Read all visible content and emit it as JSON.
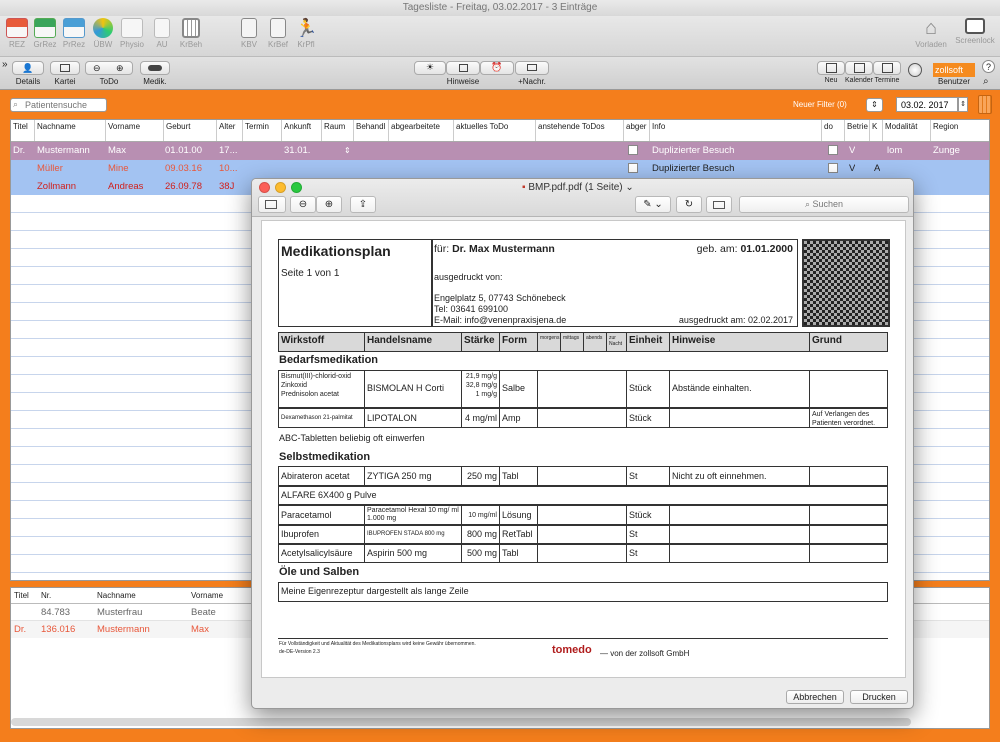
{
  "window": {
    "title": "Tagesliste - Freitag, 03.02.2017 - 3 Einträge"
  },
  "toolbar": {
    "items": [
      {
        "label": "REZ"
      },
      {
        "label": "GrRez"
      },
      {
        "label": "PrRez"
      },
      {
        "label": "ÜBW"
      },
      {
        "label": "Physio"
      },
      {
        "label": "AU"
      },
      {
        "label": "KrBeh"
      },
      {
        "label": "KBV"
      },
      {
        "label": "KrBef"
      },
      {
        "label": "KrPfl"
      }
    ],
    "vorladen": "Vorladen",
    "screenlock": "Screenlock"
  },
  "toolbar2": {
    "details": "Details",
    "kartei": "Kartei",
    "todo": "ToDo",
    "medik": "Medik.",
    "hinweise": "Hinweise",
    "nachr": "+Nachr.",
    "neu": "Neu",
    "kalender": "Kalender",
    "termine": "Termine",
    "user_badge": "zollsoft",
    "benutzer": "Benutzer"
  },
  "filterbar": {
    "search_placeholder": "Patientensuche",
    "filter_label": "Neuer Filter (0)",
    "date": "03.02. 2017"
  },
  "list": {
    "headers": [
      "Titel",
      "Nachname",
      "Vorname",
      "Geburt",
      "Alter",
      "Termin",
      "Ankunft",
      "Raum",
      "Behandl",
      "abgearbeitete",
      "aktuelles ToDo",
      "anstehende ToDos",
      "abger",
      "Info",
      "do",
      "Betrie",
      "K",
      "Modalität",
      "Region"
    ],
    "rows": [
      {
        "titel": "Dr.",
        "nachname": "Mustermann",
        "vorname": "Max",
        "geburt": "01.01.00",
        "alter": "17...",
        "ankunft": "31.01.",
        "info": "Duplizierter Besuch",
        "betrieb": "V",
        "modalitaet": "lom",
        "region": "Zunge"
      },
      {
        "titel": "",
        "nachname": "Müller",
        "vorname": "Mine",
        "geburt": "09.03.16",
        "alter": "10...",
        "ankunft": "",
        "info": "Duplizierter Besuch",
        "betrieb": "V",
        "k": "A"
      },
      {
        "titel": "",
        "nachname": "Zollmann",
        "vorname": "Andreas",
        "geburt": "26.09.78",
        "alter": "38J",
        "ankunft": ""
      }
    ]
  },
  "bottom": {
    "headers": [
      "Titel",
      "Nr.",
      "Nachname",
      "Vorname"
    ],
    "rows": [
      {
        "titel": "",
        "nr": "84.783",
        "nachname": "Musterfrau",
        "vorname": "Beate"
      },
      {
        "titel": "Dr.",
        "nr": "136.016",
        "nachname": "Mustermann",
        "vorname": "Max"
      }
    ]
  },
  "pdf": {
    "title": "BMP.pdf.pdf (1 Seite)",
    "search_placeholder": "Suchen",
    "cancel": "Abbrechen",
    "print": "Drucken",
    "doc": {
      "title": "Medikationsplan",
      "page": "Seite 1 von 1",
      "for_label": "für:",
      "patient": "Dr. Max Mustermann",
      "dob_label": "geb. am:",
      "dob": "01.01.2000",
      "printed_by": "ausgedruckt von:",
      "address": "Engelplatz 5, 07743 Schönebeck",
      "tel": "Tel: 03641 699100",
      "email": "E-Mail: info@venenpraxisjena.de",
      "printed_on": "ausgedruckt am: 02.02.2017",
      "headers": [
        "Wirkstoff",
        "Handelsname",
        "Stärke",
        "Form",
        "morgens",
        "mittags",
        "abends",
        "zur Nacht",
        "Einheit",
        "Hinweise",
        "Grund"
      ],
      "sec1": "Bedarfsmedikation",
      "sec2": "Selbstmedikation",
      "sec3": "Öle und Salben",
      "r1": {
        "wirkstoff": [
          "Bismut(III)-chlorid-oxid",
          "Zinkoxid",
          "Prednisolon acetat"
        ],
        "handel": "BISMOLAN H Corti",
        "staerke": [
          "21,9 mg/g",
          "32,8 mg/g",
          "1 mg/g"
        ],
        "form": "Salbe",
        "einheit": "Stück",
        "hinweis": "Abstände einhalten."
      },
      "r2": {
        "wirkstoff": "Dexamethason 21-palmitat",
        "handel": "LIPOTALON",
        "staerke": "4 mg/ml",
        "form": "Amp",
        "einheit": "Stück",
        "grund": "Auf Verlangen des Patienten verordnet."
      },
      "free1": "ABC-Tabletten beliebig oft einwerfen",
      "r3": {
        "wirkstoff": "Abirateron acetat",
        "handel": "ZYTIGA 250 mg",
        "staerke": "250 mg",
        "form": "Tabl",
        "einheit": "St",
        "hinweis": "Nicht zu oft einnehmen."
      },
      "free2": "ALFARE 6X400 g Pulve",
      "r4": {
        "wirkstoff": "Paracetamol",
        "handel": "Paracetamol Hexal 10 mg/ ml 1.000 mg",
        "staerke": "10 mg/ml",
        "form": "Lösung",
        "einheit": "Stück"
      },
      "r5": {
        "wirkstoff": "Ibuprofen",
        "handel": "IBUPROFEN STADA 800 mg",
        "staerke": "800 mg",
        "form": "RetTabl",
        "einheit": "St"
      },
      "r6": {
        "wirkstoff": "Acetylsalicylsäure",
        "handel": "Aspirin 500 mg",
        "staerke": "500 mg",
        "form": "Tabl",
        "einheit": "St"
      },
      "free3": "Meine Eigenrezeptur dargestellt als lange Zeile",
      "footer1": "Für Vollständigkeit und Aktualität des Medikationsplans wird keine Gewähr übernommen.",
      "footer2": "de-DE-Version 2.3",
      "brand": "tomedo",
      "brand_suffix": "— von der zollsoft GmbH"
    }
  }
}
